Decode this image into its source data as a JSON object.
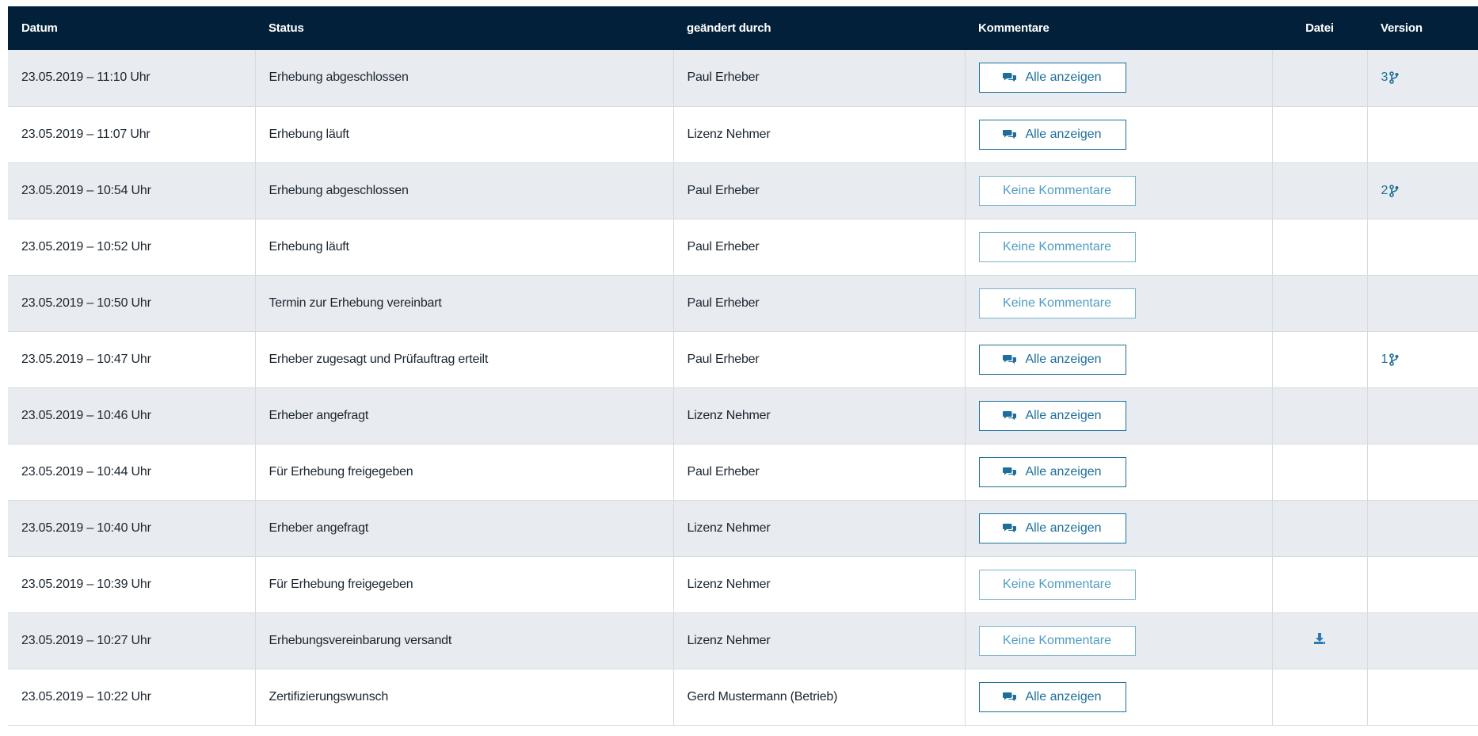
{
  "table": {
    "headers": {
      "datum": "Datum",
      "status": "Status",
      "geaendert": "geändert durch",
      "kommentare": "Kommentare",
      "datei": "Datei",
      "version": "Version"
    },
    "rows": [
      {
        "datum": "23.05.2019 – 11:10 Uhr",
        "status": "Erhebung abgeschlossen",
        "by": "Paul Erheber",
        "comments": "Alle anzeigen",
        "has_comments": true,
        "file": false,
        "version": "3"
      },
      {
        "datum": "23.05.2019 – 11:07 Uhr",
        "status": "Erhebung läuft",
        "by": "Lizenz Nehmer",
        "comments": "Alle anzeigen",
        "has_comments": true,
        "file": false,
        "version": ""
      },
      {
        "datum": "23.05.2019 – 10:54 Uhr",
        "status": "Erhebung abgeschlossen",
        "by": "Paul Erheber",
        "comments": "Keine Kommentare",
        "has_comments": false,
        "file": false,
        "version": "2"
      },
      {
        "datum": "23.05.2019 – 10:52 Uhr",
        "status": "Erhebung läuft",
        "by": "Paul Erheber",
        "comments": "Keine Kommentare",
        "has_comments": false,
        "file": false,
        "version": ""
      },
      {
        "datum": "23.05.2019 – 10:50 Uhr",
        "status": "Termin zur Erhebung vereinbart",
        "by": "Paul Erheber",
        "comments": "Keine Kommentare",
        "has_comments": false,
        "file": false,
        "version": ""
      },
      {
        "datum": "23.05.2019 – 10:47 Uhr",
        "status": "Erheber zugesagt und Prüfauftrag erteilt",
        "by": "Paul Erheber",
        "comments": "Alle anzeigen",
        "has_comments": true,
        "file": false,
        "version": "1"
      },
      {
        "datum": "23.05.2019 – 10:46 Uhr",
        "status": "Erheber angefragt",
        "by": "Lizenz Nehmer",
        "comments": "Alle anzeigen",
        "has_comments": true,
        "file": false,
        "version": ""
      },
      {
        "datum": "23.05.2019 – 10:44 Uhr",
        "status": "Für Erhebung freigegeben",
        "by": "Paul Erheber",
        "comments": "Alle anzeigen",
        "has_comments": true,
        "file": false,
        "version": ""
      },
      {
        "datum": "23.05.2019 – 10:40 Uhr",
        "status": "Erheber angefragt",
        "by": "Lizenz Nehmer",
        "comments": "Alle anzeigen",
        "has_comments": true,
        "file": false,
        "version": ""
      },
      {
        "datum": "23.05.2019 – 10:39 Uhr",
        "status": "Für Erhebung freigegeben",
        "by": "Lizenz Nehmer",
        "comments": "Keine Kommentare",
        "has_comments": false,
        "file": false,
        "version": ""
      },
      {
        "datum": "23.05.2019 – 10:27 Uhr",
        "status": "Erhebungsvereinbarung versandt",
        "by": "Lizenz Nehmer",
        "comments": "Keine Kommentare",
        "has_comments": false,
        "file": true,
        "version": ""
      },
      {
        "datum": "23.05.2019 – 10:22 Uhr",
        "status": "Zertifizierungswunsch",
        "by": "Gerd Mustermann (Betrieb)",
        "comments": "Alle anzeigen",
        "has_comments": true,
        "file": false,
        "version": ""
      }
    ]
  },
  "icons": {
    "comments": "comments-icon",
    "download": "download-icon",
    "version": "branch-icon"
  },
  "colors": {
    "header_bg": "#03203a",
    "row_alt": "#e8ebef",
    "accent": "#1d6f9a",
    "accent_light": "#4e9cc3"
  }
}
